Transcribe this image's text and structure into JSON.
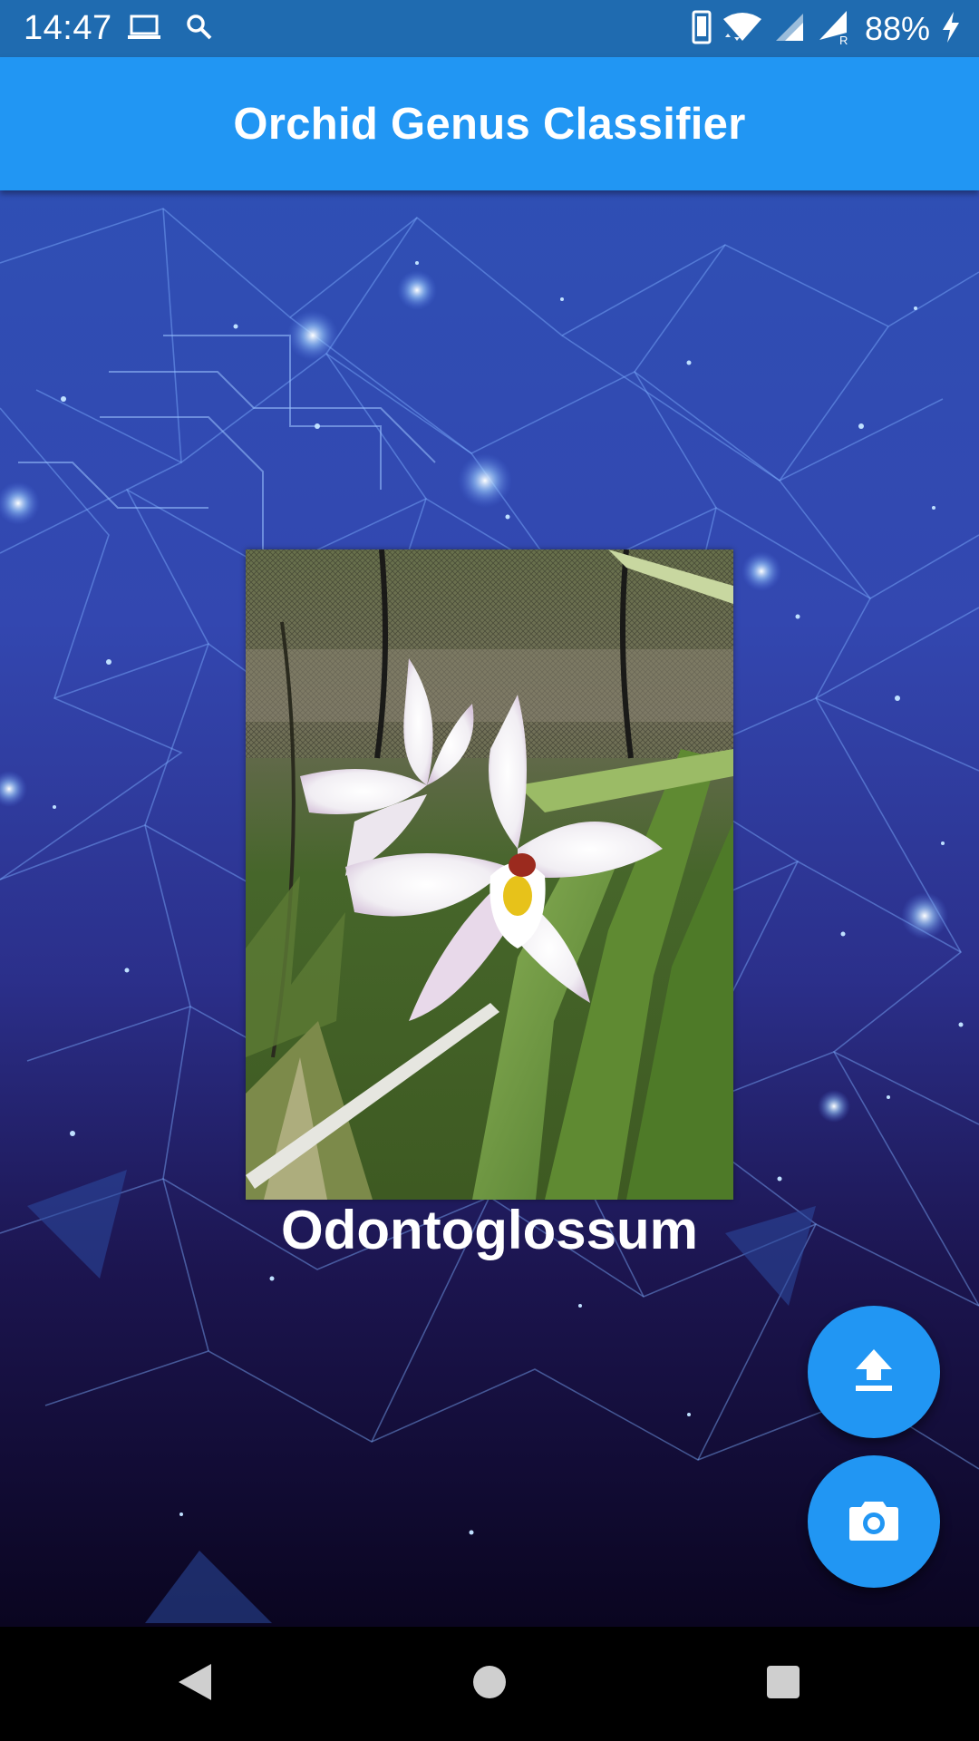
{
  "status_bar": {
    "time": "14:47",
    "battery_percent": "88%",
    "icons": [
      "laptop-icon",
      "search-icon",
      "phone-icon",
      "wifi-icon",
      "signal-icon",
      "signal-roaming-icon",
      "charging-bolt-icon"
    ]
  },
  "app_bar": {
    "title": "Orchid Genus Classifier"
  },
  "main": {
    "prediction_label": "Odontoglossum"
  },
  "fabs": {
    "upload_icon": "upload-icon",
    "camera_icon": "camera-icon"
  },
  "nav_bar": {
    "icons": [
      "back-icon",
      "home-icon",
      "recents-icon"
    ]
  },
  "colors": {
    "status_bar": "#1f6bb0",
    "app_bar": "#2196f3",
    "fab": "#2196f3",
    "nav_bar": "#000000"
  }
}
